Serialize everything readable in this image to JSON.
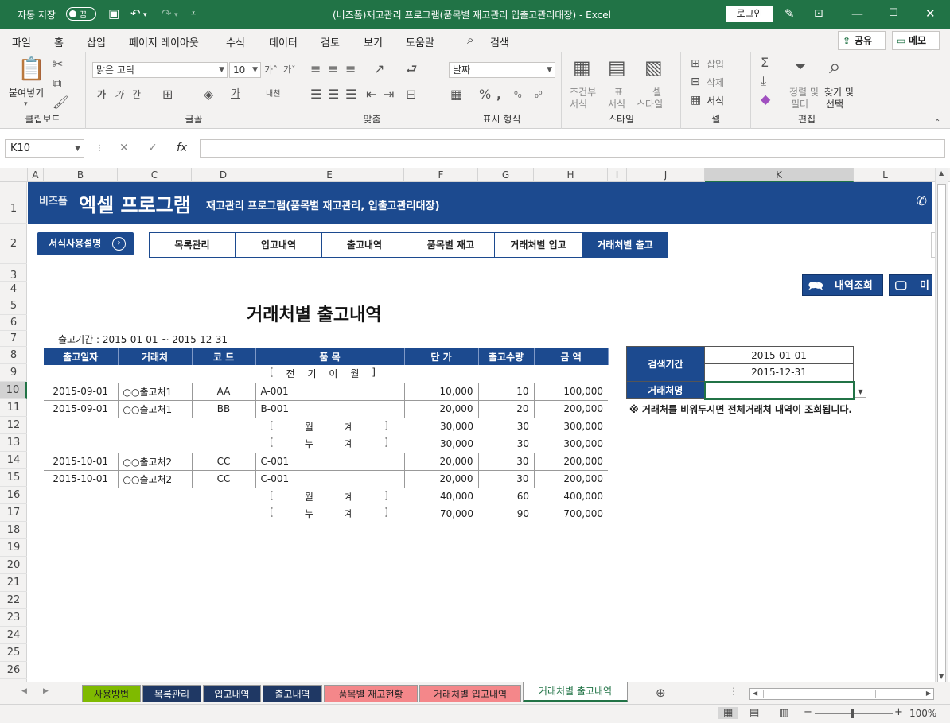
{
  "titlebar": {
    "autosave_label": "자동 저장",
    "toggle_state": "끔",
    "document_title": "(비즈폼)재고관리 프로그램(품목별 재고관리 입출고관리대장) - Excel",
    "login_label": "로그인"
  },
  "menu": {
    "items": [
      "파일",
      "홈",
      "삽입",
      "페이지 레이아웃",
      "수식",
      "데이터",
      "검토",
      "보기",
      "도움말"
    ],
    "search_label": "검색",
    "share_label": "공유",
    "memo_label": "메모"
  },
  "ribbon": {
    "paste_label": "붙여넣기",
    "font_name": "맑은 고딕",
    "font_size": "10",
    "number_format": "날짜",
    "groups": [
      "클립보드",
      "글꼴",
      "맞춤",
      "표시 형식",
      "스타일",
      "셀",
      "편집"
    ],
    "cond_format": [
      "조건부",
      "서식"
    ],
    "table_format": [
      "표",
      "서식"
    ],
    "cell_style": [
      "셀",
      "스타일"
    ],
    "insert_label": "삽입",
    "delete_label": "삭제",
    "format_label": "서식",
    "sort_filter": [
      "정렬 및",
      "필터"
    ],
    "find_select": [
      "찾기 및",
      "선택"
    ]
  },
  "formula_bar": {
    "name_box": "K10",
    "fx": "fx",
    "value": ""
  },
  "columns": [
    "A",
    "B",
    "C",
    "D",
    "E",
    "F",
    "G",
    "H",
    "I",
    "J",
    "K",
    "L"
  ],
  "rows": [
    "1",
    "2",
    "3",
    "4",
    "5",
    "6",
    "7",
    "8",
    "9",
    "10",
    "11",
    "12",
    "13",
    "14",
    "15",
    "16",
    "17",
    "18",
    "19",
    "20",
    "21",
    "22",
    "23",
    "24",
    "25",
    "26"
  ],
  "banner": {
    "brand": "비즈폼",
    "program": "엑셀 프로그램",
    "subtitle": "재고관리 프로그램(품목별 재고관리, 입출고관리대장)"
  },
  "nav": {
    "manual_label": "서식사용설명",
    "tabs": [
      "목록관리",
      "입고내역",
      "출고내역",
      "품목별 재고",
      "거래처별 입고",
      "거래처별 출고"
    ],
    "active": "거래처별 출고"
  },
  "actions": {
    "lookup_label": "내역조회",
    "second_label": "미"
  },
  "report": {
    "title": "거래처별 출고내역",
    "period_label": "출고기간 : 2015-01-01 ~ 2015-12-31",
    "headers": [
      "출고일자",
      "거래처",
      "코 드",
      "품 목",
      "단 가",
      "출고수량",
      "금 액"
    ],
    "carry_label": [
      "전",
      "기",
      "이",
      "월"
    ],
    "month_total": [
      "월",
      "계"
    ],
    "cumulative": [
      "누",
      "계"
    ],
    "rows": [
      {
        "type": "carry"
      },
      {
        "type": "data",
        "date": "2015-09-01",
        "client": "○○출고처1",
        "code": "AA",
        "item": "A-001",
        "price": "10,000",
        "qty": "10",
        "amount": "100,000"
      },
      {
        "type": "data",
        "date": "2015-09-01",
        "client": "○○출고처1",
        "code": "BB",
        "item": "B-001",
        "price": "20,000",
        "qty": "20",
        "amount": "200,000"
      },
      {
        "type": "month",
        "price": "30,000",
        "qty": "30",
        "amount": "300,000"
      },
      {
        "type": "cum",
        "price": "30,000",
        "qty": "30",
        "amount": "300,000"
      },
      {
        "type": "data",
        "date": "2015-10-01",
        "client": "○○출고처2",
        "code": "CC",
        "item": "C-001",
        "price": "20,000",
        "qty": "30",
        "amount": "200,000"
      },
      {
        "type": "data",
        "date": "2015-10-01",
        "client": "○○출고처2",
        "code": "CC",
        "item": "C-001",
        "price": "20,000",
        "qty": "30",
        "amount": "200,000"
      },
      {
        "type": "month",
        "price": "40,000",
        "qty": "60",
        "amount": "400,000"
      },
      {
        "type": "cum",
        "price": "70,000",
        "qty": "90",
        "amount": "700,000"
      }
    ]
  },
  "search": {
    "period_label": "검색기간",
    "start": "2015-01-01",
    "end": "2015-12-31",
    "client_label": "거래처명",
    "client_value": "",
    "note": "※ 거래처를 비워두시면 전체거래처 내역이 조회됩니다."
  },
  "sheet_tabs": [
    {
      "label": "사용방법",
      "color": "#7fba00"
    },
    {
      "label": "목록관리",
      "color": "#1f3864"
    },
    {
      "label": "입고내역",
      "color": "#1f3864"
    },
    {
      "label": "출고내역",
      "color": "#1f3864"
    },
    {
      "label": "품목별 재고현황",
      "color": "#f4878a"
    },
    {
      "label": "거래처별 입고내역",
      "color": "#f4878a"
    },
    {
      "label": "거래처별 출고내역",
      "color": "#ffffff"
    }
  ],
  "status": {
    "zoom": "100%"
  },
  "colors": {
    "excel_green": "#217346",
    "brand_blue": "#1c4a8f"
  }
}
